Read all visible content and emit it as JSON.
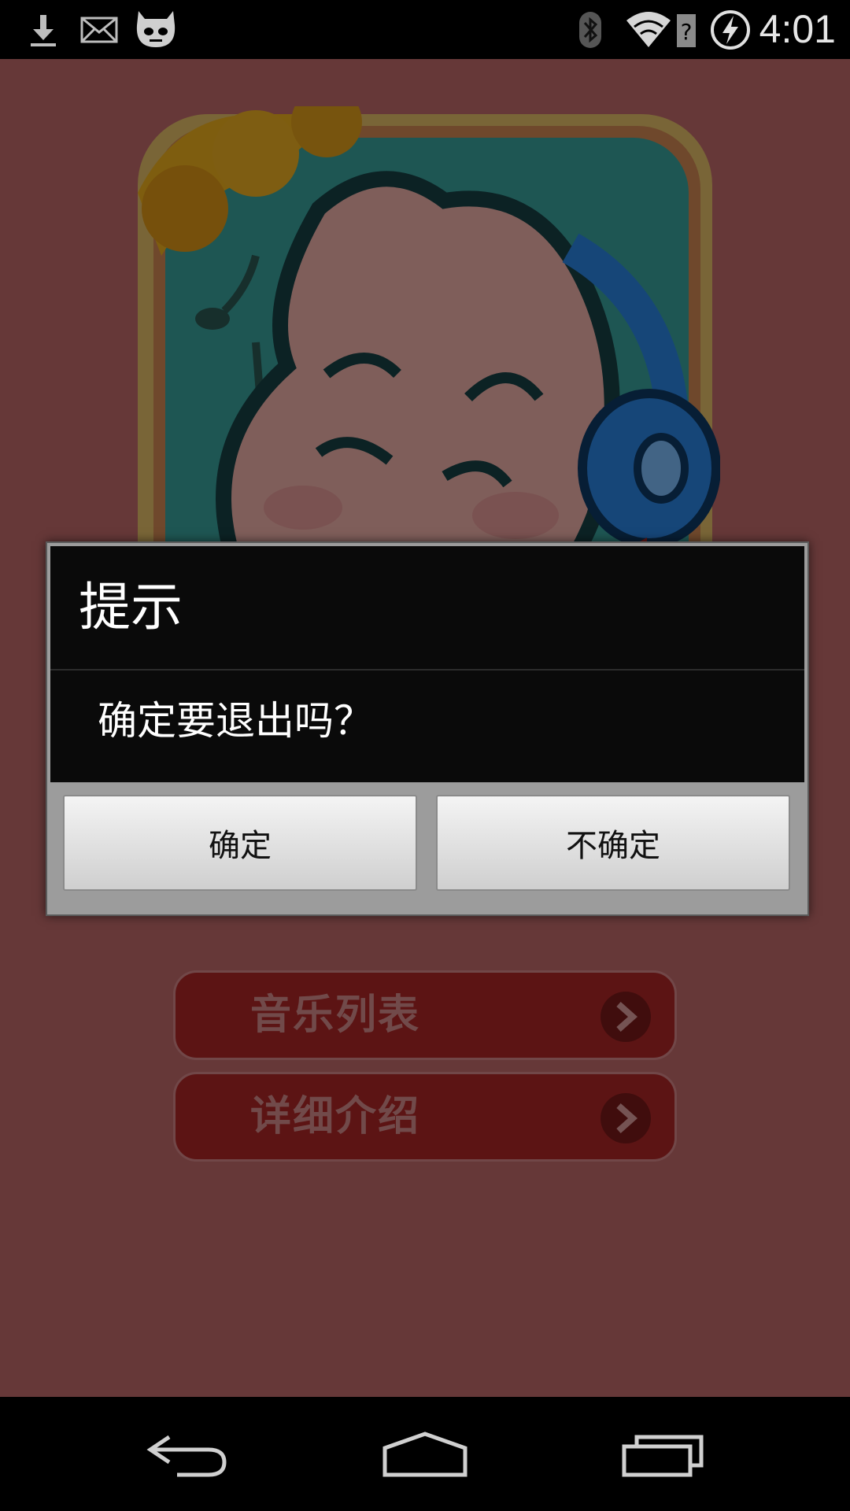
{
  "status_bar": {
    "time": "4:01",
    "left_icons": [
      "download-icon",
      "mail-icon",
      "cyanogen-mascot-icon"
    ],
    "right_icons": [
      "bluetooth-icon",
      "wifi-no-internet-icon",
      "battery-charging-icon"
    ]
  },
  "app": {
    "background_color": "#c46b6c",
    "menu": [
      {
        "label": "音乐列表",
        "icon": "chevron-right-icon"
      },
      {
        "label": "详细介绍",
        "icon": "chevron-right-icon"
      }
    ]
  },
  "dialog": {
    "title": "提示",
    "message": "确定要退出吗？",
    "confirm_label": "确定",
    "cancel_label": "不确定"
  },
  "nav_bar": {
    "icons": [
      "back-icon",
      "home-icon",
      "recents-icon"
    ]
  }
}
